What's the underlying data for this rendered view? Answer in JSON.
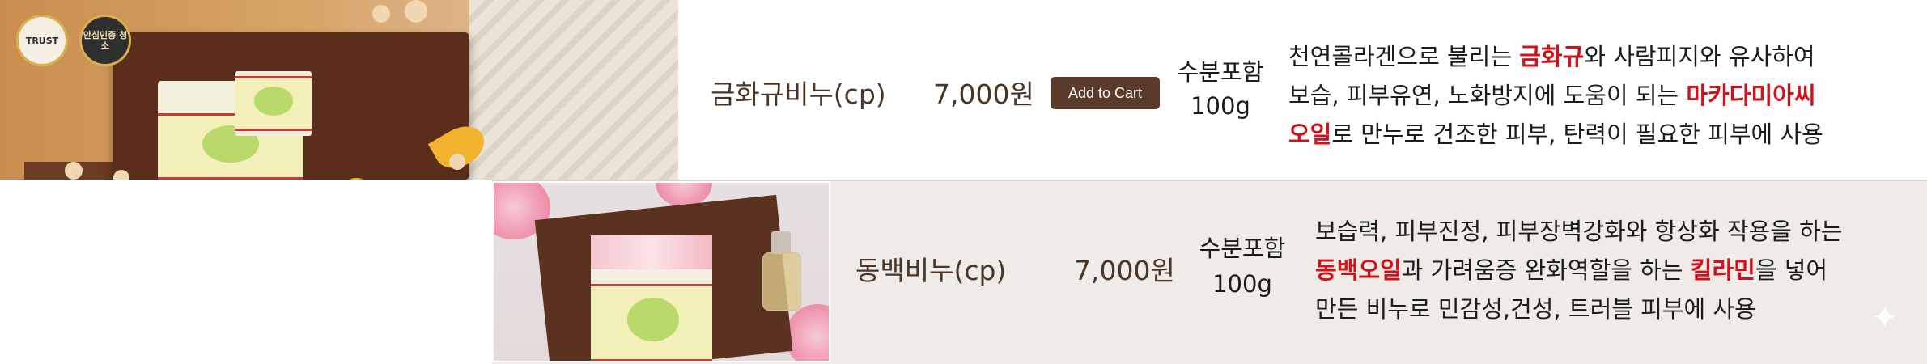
{
  "badges": {
    "trust": "TRUST",
    "cert": "안심인증 청소"
  },
  "products": [
    {
      "name": "금화규비누(cp)",
      "price": "7,000원",
      "cart_label": "Add to Cart",
      "moisture_line1": "수분포함",
      "moisture_line2": "100g",
      "desc": [
        [
          "천연콜라겐으로 불리는 ",
          "금화규",
          "와 사람피지와 유사하여"
        ],
        [
          "보습, 피부유연, 노화방지에 도움이 되는 ",
          "마카다미아씨",
          ""
        ],
        [
          "",
          "오일",
          "로 만누로 건조한 피부, 탄력이 필요한 피부에 사용"
        ]
      ]
    },
    {
      "name": "동백비누(cp)",
      "price": "7,000원",
      "moisture_line1": "수분포함",
      "moisture_line2": "100g",
      "desc": [
        [
          "보습력, 피부진정, 피부장벽강화와 항상화 작용을 하는",
          "",
          ""
        ],
        [
          "",
          "동백오일",
          "과 가려움증 완화역할을 하는 "
        ],
        [
          "만든 비누로 민감성,건성, 트러블 피부에 사용",
          "",
          ""
        ]
      ],
      "desc_line2_hl2": "킬라민",
      "desc_line2_tail": "을 넣어"
    }
  ],
  "colors": {
    "highlight": "#d4111b",
    "cart_button": "#5a3a2b",
    "name_text": "#4a3526"
  }
}
